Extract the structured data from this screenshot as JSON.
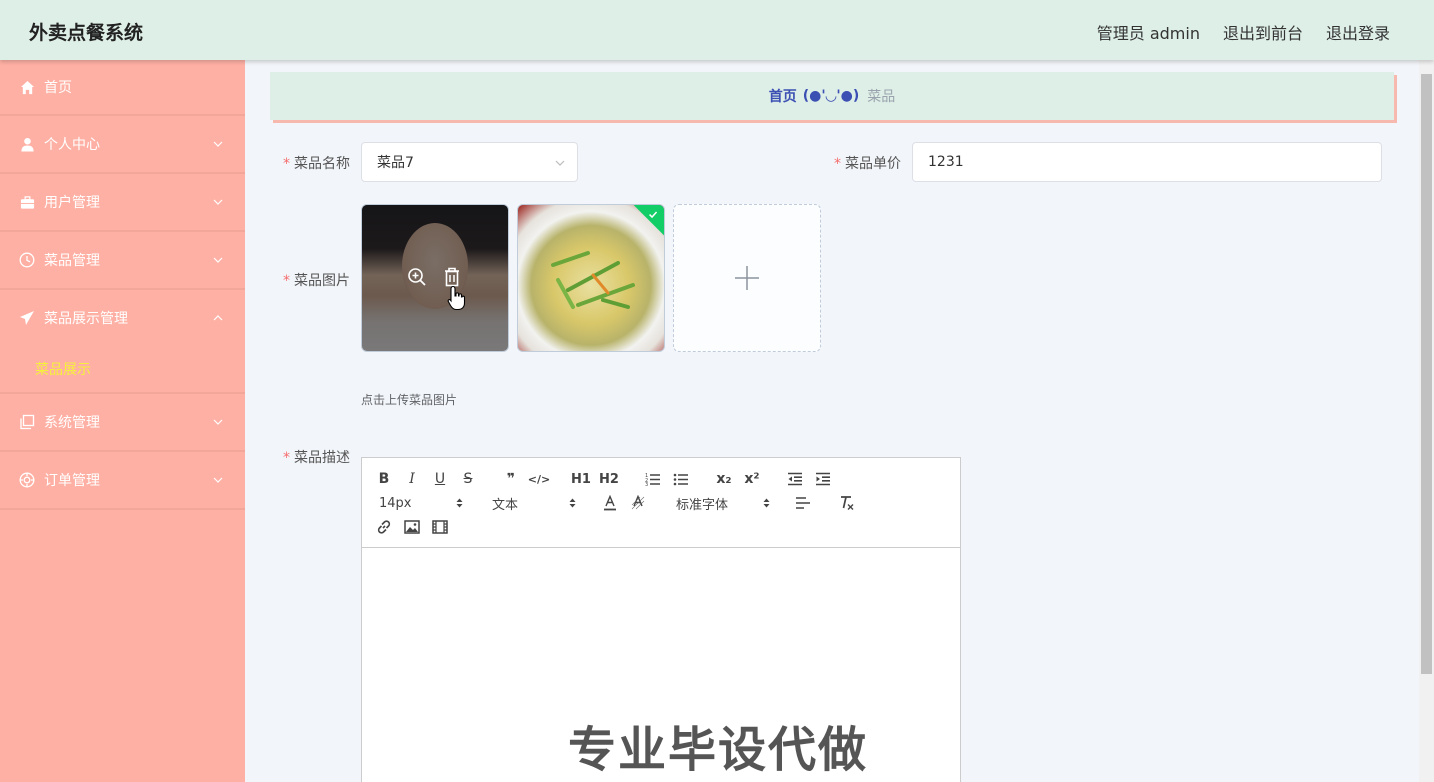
{
  "header": {
    "brand": "外卖点餐系统",
    "admin_label": "管理员 admin",
    "to_front_label": "退出到前台",
    "logout_label": "退出登录",
    "bg_color": "#deefe7"
  },
  "sidebar": {
    "bg_color": "#ffb0a4",
    "items": [
      {
        "label": "首页",
        "icon": "home-icon"
      },
      {
        "label": "个人中心",
        "icon": "user-icon"
      },
      {
        "label": "用户管理",
        "icon": "briefcase-icon"
      },
      {
        "label": "菜品管理",
        "icon": "clock-icon"
      },
      {
        "label": "菜品展示管理",
        "icon": "send-icon",
        "expanded": true,
        "children": [
          "菜品展示"
        ]
      },
      {
        "label": "系统管理",
        "icon": "copy-icon"
      },
      {
        "label": "订单管理",
        "icon": "target-icon"
      }
    ]
  },
  "breadcrumb": {
    "home": "首页",
    "separator": "(●'◡'●)",
    "current": "菜品"
  },
  "form": {
    "name_label": "菜品名称",
    "name_value": "菜品7",
    "price_label": "菜品单价",
    "price_value": "1231",
    "image_label": "菜品图片",
    "upload_tip": "点击上传菜品图片",
    "desc_label": "菜品描述",
    "required_mark": "*"
  },
  "editor": {
    "font_size": "14px",
    "text_type": "文本",
    "font_family": "标准字体",
    "buttons": [
      "B",
      "I",
      "U",
      "S",
      "❞",
      "</>",
      "H1",
      "H2",
      "ol",
      "ul",
      "x₂",
      "x²",
      "outdent",
      "indent",
      "A",
      "bg",
      "align",
      "Tx",
      "link",
      "image",
      "video"
    ]
  },
  "watermark": "专业毕设代做"
}
